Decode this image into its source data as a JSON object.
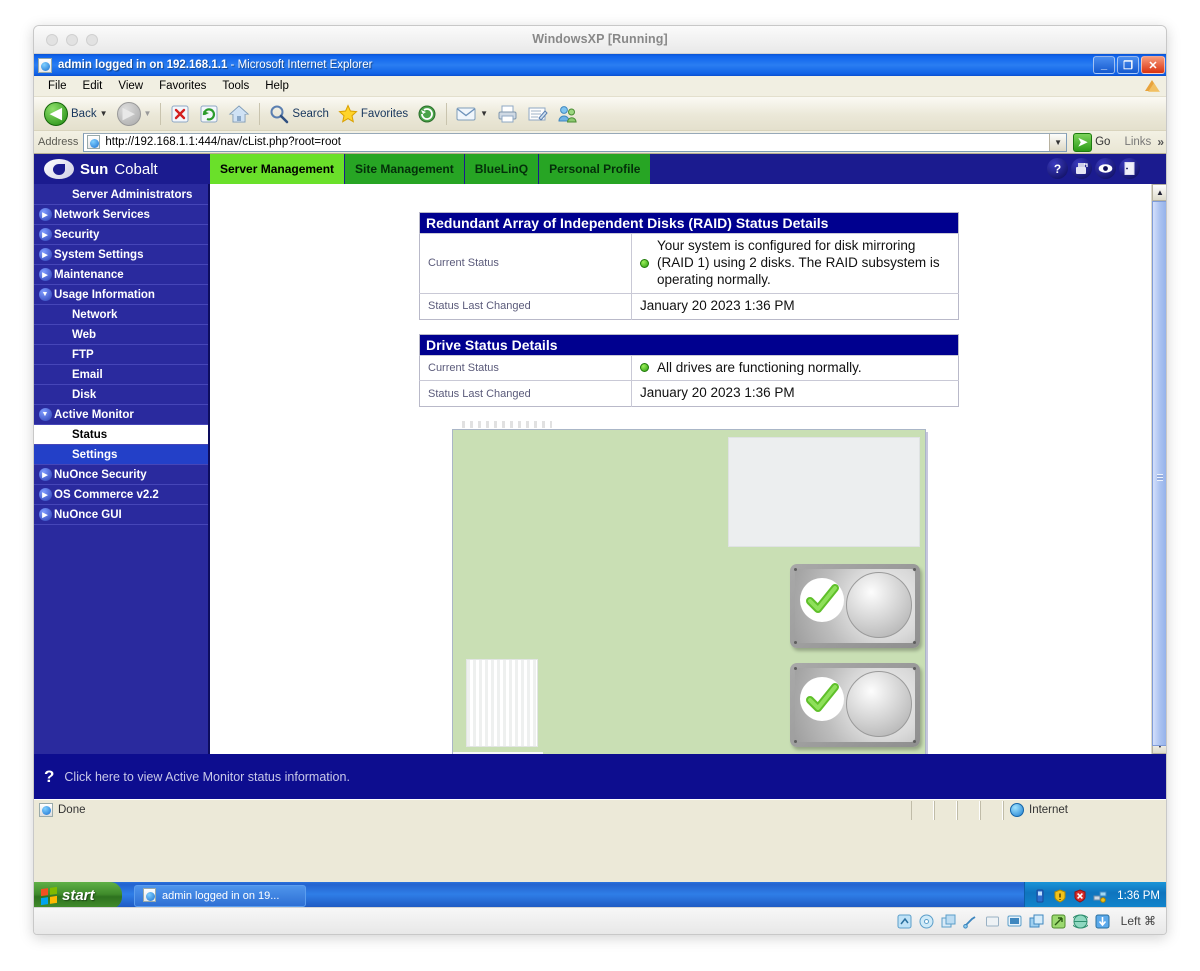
{
  "vbox": {
    "title": "WindowsXP [Running]",
    "statusbar_keys": "Left ⌘",
    "status_icons": [
      "hard-disk-icon",
      "cd-icon",
      "floppy-icon",
      "usb-icon",
      "shared-folder-icon",
      "display-icon",
      "network-icon",
      "shared-clipboard-icon",
      "globe-icon",
      "capture-icon"
    ]
  },
  "ie": {
    "title_main": "admin logged in on 192.168.1.1",
    "title_sub": " - Microsoft Internet Explorer",
    "menu": [
      "File",
      "Edit",
      "View",
      "Favorites",
      "Tools",
      "Help"
    ],
    "window_buttons": {
      "minimize": "_",
      "maximize": "❐",
      "close": "✕"
    },
    "toolbar": {
      "back": "Back",
      "search": "Search",
      "favorites": "Favorites",
      "items": [
        "back-button",
        "forward-button",
        "stop-button",
        "refresh-button",
        "home-button",
        "search-button",
        "favorites-button",
        "history-button",
        "mail-button",
        "print-button",
        "edit-button",
        "messenger-button"
      ]
    },
    "address": {
      "label": "Address",
      "url": "http://192.168.1.1:444/nav/cList.php?root=root",
      "go": "Go",
      "links": "Links",
      "links_chevron": "»"
    },
    "status": {
      "text": "Done",
      "zone": "Internet"
    }
  },
  "cobalt": {
    "logo_sun": "Sun",
    "logo_cobalt": "Cobalt",
    "tabs": [
      {
        "label": "Server Management",
        "active": true
      },
      {
        "label": "Site Management",
        "active": false
      },
      {
        "label": "BlueLinQ",
        "active": false
      },
      {
        "label": "Personal Profile",
        "active": false
      }
    ],
    "header_icons": [
      "help-icon",
      "save-icon",
      "preview-icon",
      "logout-icon"
    ],
    "accent_active": "#6ae02a",
    "accent_inactive": "#27a524",
    "header_blue": "#1b1b8f"
  },
  "sidebar": {
    "items": [
      {
        "label": "Server Administrators",
        "kind": "no-tri",
        "state": "none"
      },
      {
        "label": "Network Services",
        "kind": "collapsed",
        "state": "none"
      },
      {
        "label": "Security",
        "kind": "collapsed",
        "state": "none"
      },
      {
        "label": "System Settings",
        "kind": "collapsed",
        "state": "none"
      },
      {
        "label": "Maintenance",
        "kind": "collapsed",
        "state": "none"
      },
      {
        "label": "Usage Information",
        "kind": "expanded",
        "state": "none"
      },
      {
        "label": "Network",
        "kind": "child",
        "state": "none"
      },
      {
        "label": "Web",
        "kind": "child",
        "state": "none"
      },
      {
        "label": "FTP",
        "kind": "child",
        "state": "none"
      },
      {
        "label": "Email",
        "kind": "child",
        "state": "none"
      },
      {
        "label": "Disk",
        "kind": "child",
        "state": "none"
      },
      {
        "label": "Active Monitor",
        "kind": "expanded",
        "state": "none"
      },
      {
        "label": "Status",
        "kind": "child",
        "state": "selected-white"
      },
      {
        "label": "Settings",
        "kind": "child",
        "state": "selected-blue"
      },
      {
        "label": "NuOnce Security",
        "kind": "collapsed",
        "state": "none"
      },
      {
        "label": "OS Commerce v2.2",
        "kind": "collapsed",
        "state": "none"
      },
      {
        "label": "NuOnce GUI",
        "kind": "collapsed",
        "state": "none"
      }
    ]
  },
  "main": {
    "raid_table": {
      "header": "Redundant Array of Independent Disks (RAID) Status Details",
      "rows": [
        {
          "label": "Current Status",
          "value": "Your system is configured for disk mirroring (RAID 1) using 2 disks. The RAID subsystem is operating normally.",
          "bullet": "green"
        },
        {
          "label": "Status Last Changed",
          "value": "January 20 2023 1:36 PM",
          "bullet": "none"
        }
      ]
    },
    "drive_table": {
      "header": "Drive Status Details",
      "rows": [
        {
          "label": "Current Status",
          "value": "All drives are functioning normally.",
          "bullet": "green"
        },
        {
          "label": "Status Last Changed",
          "value": "January 20 2023 1:36 PM",
          "bullet": "none"
        }
      ]
    },
    "raid_diagram": {
      "alt": "Server chassis diagram with two mirrored drives",
      "drives": [
        {
          "name": "drive-bay-1",
          "status": "ok"
        },
        {
          "name": "drive-bay-2",
          "status": "ok"
        }
      ]
    },
    "help_bar": {
      "icon": "question-mark-icon",
      "text": "Click here to view Active Monitor status information."
    }
  },
  "taskbar": {
    "start": "start",
    "task_item": "admin logged in on 19...",
    "clock": "1:36 PM",
    "tray_icons": [
      "battery-icon",
      "shield-warning-icon",
      "security-alert-icon",
      "network-icon"
    ]
  },
  "colors": {
    "table_header_blue": "#00008f",
    "status_green": "#2c9c10",
    "sidebar_blue": "#2a2a9e",
    "chassis_green": "#c9dfb4"
  }
}
